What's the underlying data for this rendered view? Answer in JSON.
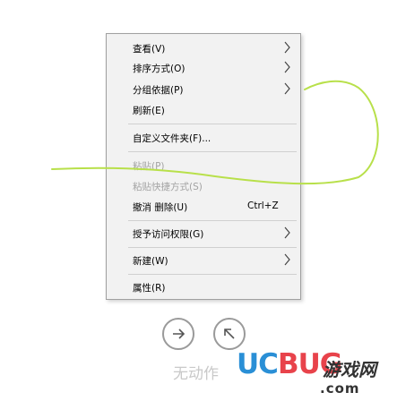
{
  "context_menu": {
    "items": [
      {
        "label": "查看(V)",
        "shortcut": "",
        "submenu": true,
        "disabled": false,
        "icon": "chevron-right-icon"
      },
      {
        "label": "排序方式(O)",
        "shortcut": "",
        "submenu": true,
        "disabled": false,
        "icon": "chevron-right-icon"
      },
      {
        "label": "分组依据(P)",
        "shortcut": "",
        "submenu": true,
        "disabled": false,
        "icon": "chevron-right-icon"
      },
      {
        "label": "刷新(E)",
        "shortcut": "",
        "submenu": false,
        "disabled": false
      },
      {
        "label": "自定义文件夹(F)...",
        "shortcut": "",
        "submenu": false,
        "disabled": false
      },
      {
        "label": "粘贴(P)",
        "shortcut": "",
        "submenu": false,
        "disabled": true
      },
      {
        "label": "粘贴快捷方式(S)",
        "shortcut": "",
        "submenu": false,
        "disabled": true
      },
      {
        "label": "撤消 删除(U)",
        "shortcut": "Ctrl+Z",
        "submenu": false,
        "disabled": false
      },
      {
        "label": "授予访问权限(G)",
        "shortcut": "",
        "submenu": true,
        "disabled": false,
        "icon": "chevron-right-icon"
      },
      {
        "label": "新建(W)",
        "shortcut": "",
        "submenu": true,
        "disabled": false,
        "icon": "chevron-right-icon"
      },
      {
        "label": "属性(R)",
        "shortcut": "",
        "submenu": false,
        "disabled": false
      }
    ]
  },
  "nav_buttons": {
    "forward_icon": "arrow-right-icon",
    "up_icon": "arrow-up-left-icon"
  },
  "status": {
    "text": "无动作"
  },
  "watermark": {
    "brand_uc": "UC",
    "brand_bug": "BUG",
    "brand_cn": "游戏网",
    "domain": ".com",
    "uc_color": "#2a8fd6",
    "bug_color": "#e8434b"
  },
  "colors": {
    "menu_bg": "#f2f2f2",
    "disabled_text": "#a3a3a3",
    "scribble": "#b8e04a"
  }
}
